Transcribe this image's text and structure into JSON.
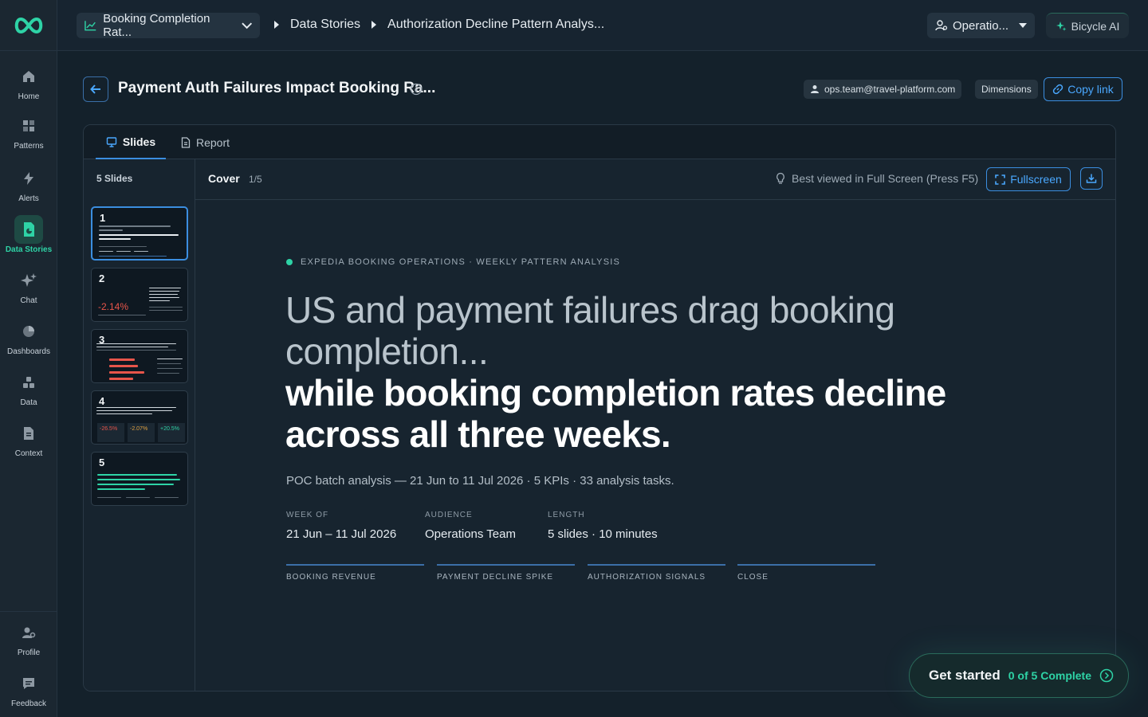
{
  "sidebar": {
    "items": [
      {
        "label": "Home"
      },
      {
        "label": "Patterns"
      },
      {
        "label": "Alerts"
      },
      {
        "label": "Data Stories"
      },
      {
        "label": "Chat"
      },
      {
        "label": "Dashboards"
      },
      {
        "label": "Data"
      },
      {
        "label": "Context"
      }
    ],
    "bottom": [
      {
        "label": "Profile"
      },
      {
        "label": "Feedback"
      }
    ]
  },
  "topbar": {
    "kpi_select": "Booking Completion Rat...",
    "breadcrumbs": [
      "Data Stories",
      "Authorization Decline Pattern Analys..."
    ],
    "team_select": "Operatio...",
    "ai_button": "Bicycle AI"
  },
  "header": {
    "title": "Payment Auth Failures Impact Booking Ra...",
    "owner": "ops.team@travel-platform.com",
    "dimensions_label": "Dimensions",
    "copy_link_label": "Copy link"
  },
  "tabs": [
    {
      "label": "Slides"
    },
    {
      "label": "Report"
    }
  ],
  "thumbnails": {
    "count_label": "5 Slides",
    "items": [
      {
        "num": "1"
      },
      {
        "num": "2",
        "value": "-2.14%"
      },
      {
        "num": "3"
      },
      {
        "num": "4",
        "values": [
          "-26.5%",
          "-2.07%",
          "+20.5%"
        ]
      },
      {
        "num": "5"
      }
    ]
  },
  "slide_head": {
    "name": "Cover",
    "position": "1/5",
    "hint": "Best viewed in Full Screen (Press F5)",
    "fullscreen_label": "Fullscreen"
  },
  "slide": {
    "eyebrow": "EXPEDIA BOOKING OPERATIONS · WEEKLY PATTERN ANALYSIS",
    "headline_light": "US and payment failures drag booking completion...",
    "headline_bold": "while booking completion rates decline across all three weeks.",
    "subline": "POC batch analysis — 21 Jun to 11 Jul 2026 · 5 KPIs · 33 analysis tasks.",
    "meta": [
      {
        "key": "WEEK OF",
        "value": "21 Jun – 11 Jul 2026"
      },
      {
        "key": "AUDIENCE",
        "value": "Operations Team"
      },
      {
        "key": "LENGTH",
        "value": "5 slides · 10 minutes"
      }
    ],
    "sections": [
      "BOOKING REVENUE",
      "PAYMENT DECLINE SPIKE",
      "AUTHORIZATION SIGNALS",
      "CLOSE"
    ]
  },
  "get_started": {
    "title": "Get started",
    "progress": "0 of 5 Complete"
  },
  "colors": {
    "accent_green": "#2ed3a6",
    "accent_blue": "#3b8ee0",
    "background": "#14212b",
    "negative_red": "#e8554a"
  }
}
